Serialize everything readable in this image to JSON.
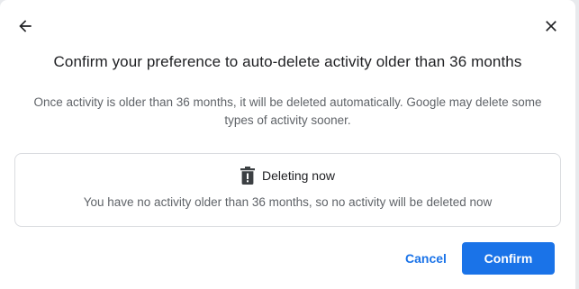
{
  "dialog": {
    "title": "Confirm your preference to auto-delete activity older than 36 months",
    "description": "Once activity is older than 36 months, it will be deleted automatically. Google may delete some types of activity sooner.",
    "back_icon": "arrow-back-icon",
    "close_icon": "close-icon"
  },
  "status_card": {
    "icon": "trash-icon",
    "heading": "Deleting now",
    "text": "You have no activity older than 36 months, so no activity will be deleted now"
  },
  "actions": {
    "cancel_label": "Cancel",
    "confirm_label": "Confirm"
  },
  "colors": {
    "accent": "#1a73e8",
    "title_text": "#202124",
    "secondary_text": "#5f6368",
    "border": "#dadce0"
  }
}
